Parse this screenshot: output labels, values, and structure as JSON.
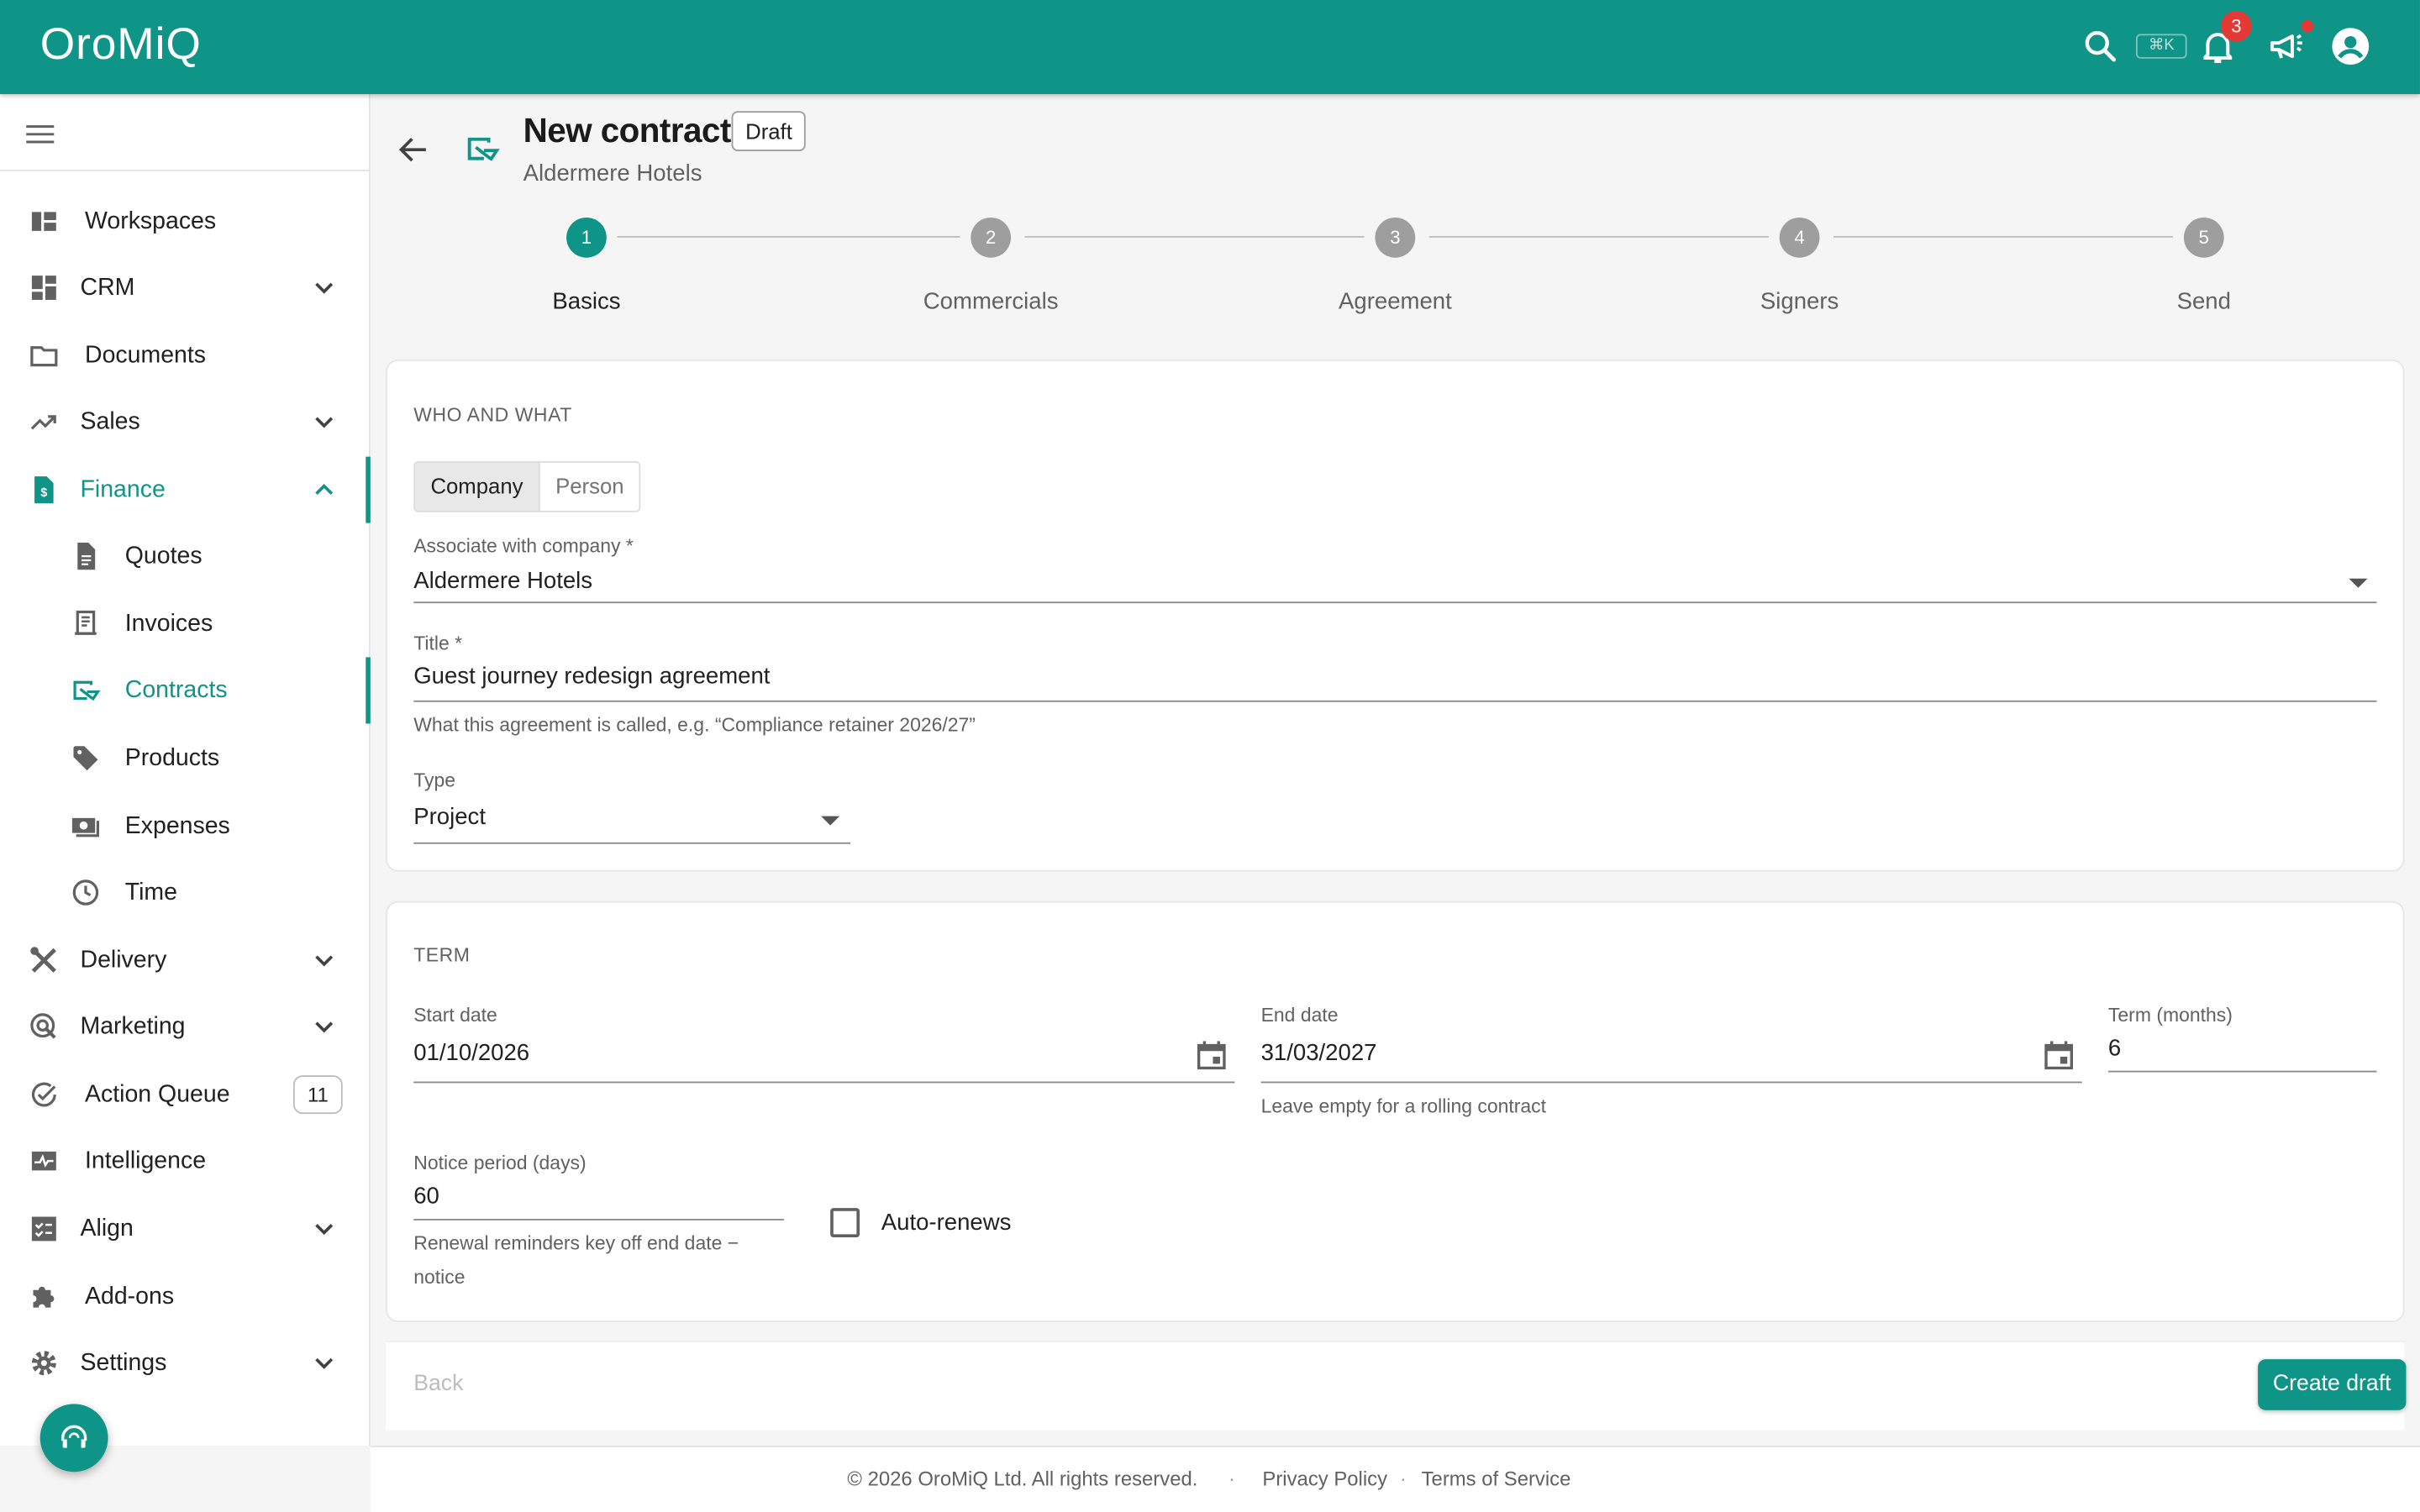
{
  "app": {
    "name": "OroMiQ",
    "shortcut": "⌘K",
    "notifications_count": "3",
    "accent": "#0f9488"
  },
  "sidebar": {
    "items": [
      {
        "label": "Workspaces",
        "icon": "workspaces-icon"
      },
      {
        "label": "CRM",
        "icon": "dashboard-icon"
      },
      {
        "label": "Documents",
        "icon": "folder-icon"
      },
      {
        "label": "Sales",
        "icon": "trending-up-icon"
      },
      {
        "label": "Finance",
        "icon": "finance-doc-icon"
      },
      {
        "label": "Quotes",
        "icon": "document-icon"
      },
      {
        "label": "Invoices",
        "icon": "receipt-icon"
      },
      {
        "label": "Contracts",
        "icon": "contract-icon"
      },
      {
        "label": "Products",
        "icon": "tag-icon"
      },
      {
        "label": "Expenses",
        "icon": "money-icon"
      },
      {
        "label": "Time",
        "icon": "clock-icon"
      },
      {
        "label": "Delivery",
        "icon": "tools-icon"
      },
      {
        "label": "Marketing",
        "icon": "target-icon"
      },
      {
        "label": "Action Queue",
        "icon": "check-circle-icon",
        "count": "11"
      },
      {
        "label": "Intelligence",
        "icon": "pulse-icon"
      },
      {
        "label": "Align",
        "icon": "checklist-icon"
      },
      {
        "label": "Add-ons",
        "icon": "puzzle-icon"
      },
      {
        "label": "Settings",
        "icon": "gear-icon"
      }
    ]
  },
  "header": {
    "title": "New contract",
    "status": "Draft",
    "subtitle": "Aldermere Hotels"
  },
  "steps": [
    {
      "number": "1",
      "label": "Basics"
    },
    {
      "number": "2",
      "label": "Commercials"
    },
    {
      "number": "3",
      "label": "Agreement"
    },
    {
      "number": "4",
      "label": "Signers"
    },
    {
      "number": "5",
      "label": "Send"
    }
  ],
  "who": {
    "section_title": "WHO AND WHAT",
    "toggle": [
      "Company",
      "Person"
    ],
    "company_label": "Associate with company *",
    "company_value": "Aldermere Hotels",
    "title_label": "Title *",
    "title_value": "Guest journey redesign agreement",
    "title_helper": "What this agreement is called, e.g. “Compliance retainer 2026/27”",
    "type_label": "Type",
    "type_value": "Project"
  },
  "term": {
    "section_title": "TERM",
    "start_label": "Start date",
    "start_value": "01/10/2026",
    "end_label": "End date",
    "end_value": "31/03/2027",
    "end_helper": "Leave empty for a rolling contract",
    "months_label": "Term (months)",
    "months_value": "6",
    "notice_label": "Notice period (days)",
    "notice_value": "60",
    "notice_helper_1": "Renewal reminders key off end date −",
    "notice_helper_2": "notice",
    "auto_renew_label": "Auto-renews"
  },
  "actions": {
    "back": "Back",
    "create": "Create draft"
  },
  "footer": {
    "copyright": "© 2026 OroMiQ Ltd. All rights reserved.",
    "privacy": "Privacy Policy",
    "terms": "Terms of Service",
    "separator": "·"
  }
}
